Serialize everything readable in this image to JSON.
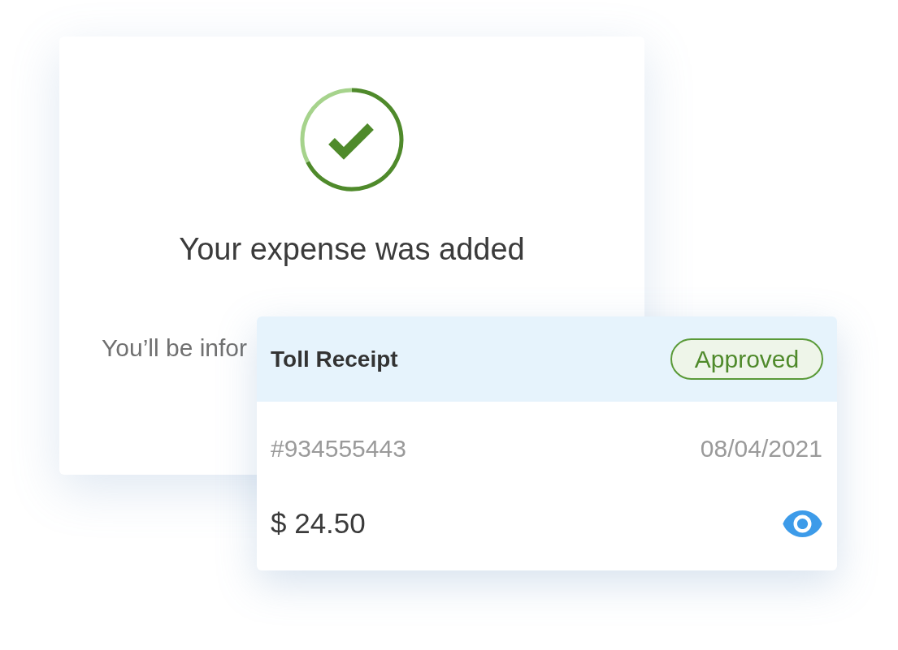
{
  "confirmation": {
    "title": "Your expense was added",
    "message": "You’ll be infor"
  },
  "receipt": {
    "title": "Toll Receipt",
    "status": "Approved",
    "number": "#934555443",
    "date": "08/04/2021",
    "amount": "$ 24.50"
  }
}
